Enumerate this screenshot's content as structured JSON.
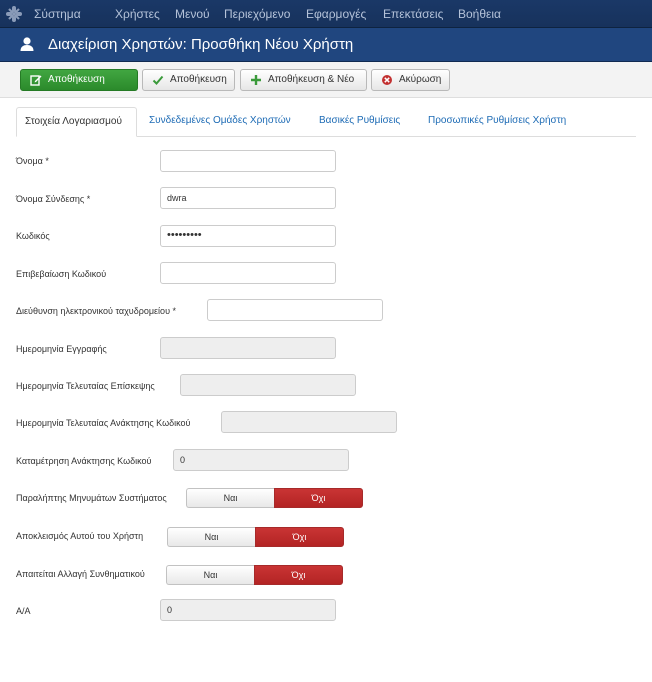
{
  "menubar": {
    "items": [
      "Σύστημα",
      "Χρήστες",
      "Μενού",
      "Περιεχόμενο",
      "Εφαρμογές",
      "Επεκτάσεις",
      "Βοήθεια"
    ]
  },
  "header": {
    "title": "Διαχείριση Χρηστών: Προσθήκη Νέου Χρήστη"
  },
  "toolbar": {
    "save": "Αποθήκευση",
    "save_close": "Αποθήκευση",
    "save_new": "Αποθήκευση & Νέο",
    "cancel": "Ακύρωση"
  },
  "tabs": {
    "account": "Στοιχεία Λογαριασμού",
    "groups": "Συνδεδεμένες Ομάδες Χρηστών",
    "basic": "Βασικές Ρυθμίσεις",
    "personal": "Προσωπικές Ρυθμίσεις Χρήστη"
  },
  "form": {
    "name_label": "Όνομα *",
    "name_value": "",
    "username_label": "Όνομα Σύνδεσης *",
    "username_value": "dwra",
    "password_label": "Κωδικός",
    "password_value": "•••••••••",
    "password2_label": "Επιβεβαίωση Κωδικού",
    "password2_value": "",
    "email_label": "Διεύθυνση ηλεκτρονικού ταχυδρομείου *",
    "email_value": "",
    "registered_label": "Ημερομηνία Εγγραφής",
    "registered_value": "",
    "lastvisit_label": "Ημερομηνία Τελευταίας Επίσκεψης",
    "lastvisit_value": "",
    "lastreset_label": "Ημερομηνία Τελευταίας Ανάκτησης Κωδικού",
    "lastreset_value": "",
    "resetcount_label": "Καταμέτρηση Ανάκτησης Κωδικού",
    "resetcount_value": "0",
    "sendemail_label": "Παραλήπτης Μηνυμάτων Συστήματος",
    "block_label": "Αποκλεισμός Αυτού του Χρήστη",
    "requirereset_label": "Απαιτείται Αλλαγή Συνθηματικού",
    "id_label": "Α/Α",
    "id_value": "0",
    "yes": "Ναι",
    "no": "Όχι"
  },
  "colors": {
    "topbar": "#1a3867",
    "titlebar": "#20467f",
    "save_green": "#359935",
    "toggle_red": "#bd2c2c",
    "link_blue": "#1d6bb5"
  },
  "icons": [
    "joomla-logo-icon",
    "user-icon",
    "edit-icon",
    "check-icon",
    "plus-icon",
    "cancel-icon"
  ]
}
